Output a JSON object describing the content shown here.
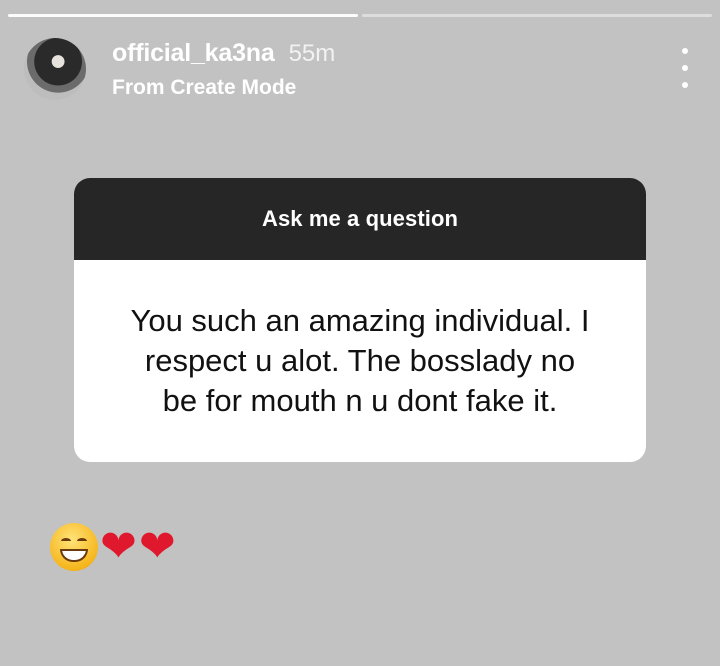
{
  "story": {
    "progress_segments": 2,
    "active_segment": 0
  },
  "header": {
    "username": "official_ka3na",
    "time_ago": "55m",
    "subtitle": "From Create Mode",
    "avatar_icon": "profile-photo",
    "menu_icon": "more-vertical-icon"
  },
  "question_card": {
    "title": "Ask me a question",
    "message": "You such an amazing individual.  I\nrespect u alot. The bosslady no\nbe for mouth n u dont  fake it."
  },
  "reactions": {
    "items": [
      "😄",
      "❤",
      "❤"
    ]
  },
  "colors": {
    "background": "#c2c2c2",
    "card_header": "#262626",
    "card_body": "#ffffff",
    "heart": "#e0182d"
  }
}
